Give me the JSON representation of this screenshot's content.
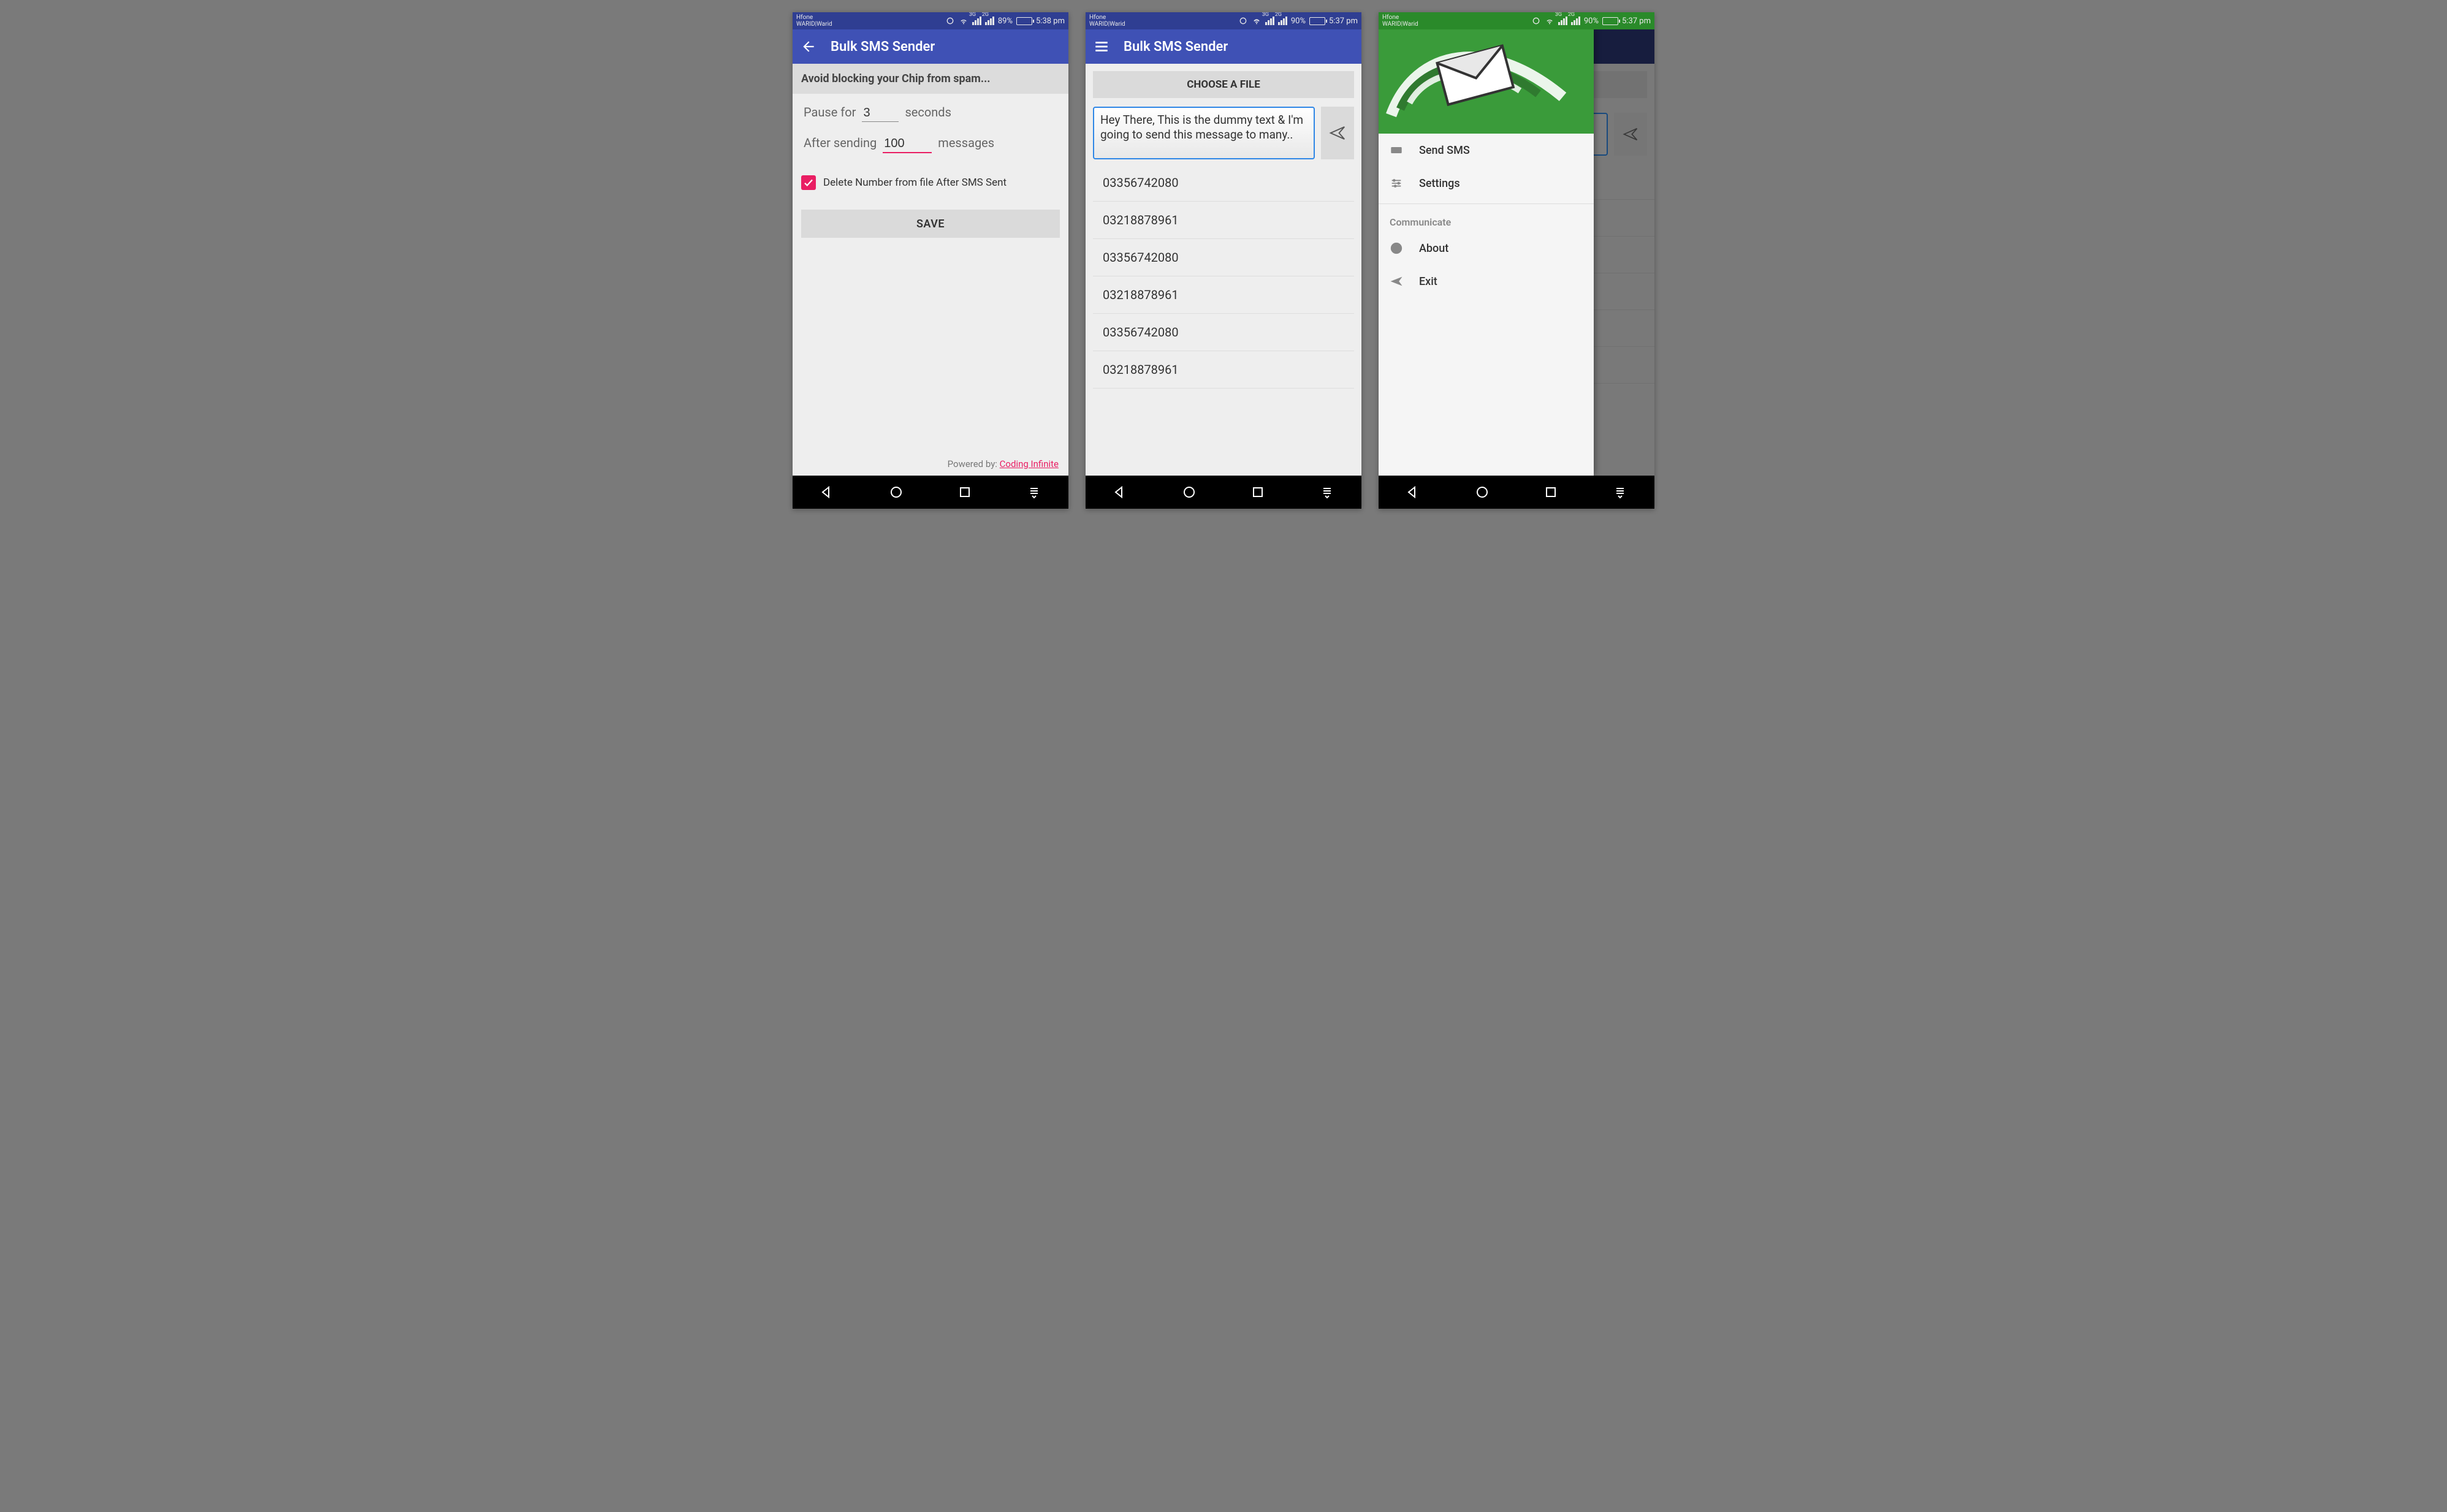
{
  "screens": {
    "s1": {
      "status": {
        "carrier": "Hfone\nWARID|Warid",
        "sig1": "3G",
        "sig2": "2G",
        "battery_pct": "89%",
        "time": "5:38 pm"
      },
      "appbar_title": "Bulk SMS Sender",
      "section_head": "Avoid blocking your Chip from spam...",
      "pause_label_pre": "Pause for",
      "pause_value": "3",
      "pause_label_post": "seconds",
      "after_label_pre": "After sending",
      "after_value": "100",
      "after_label_post": "messages",
      "checkbox_label": "Delete Number from file After SMS Sent",
      "save_label": "SAVE",
      "footer_pre": "Powered by: ",
      "footer_link": "Coding Infinite"
    },
    "s2": {
      "status": {
        "carrier": "Hfone\nWARID|Warid",
        "sig1": "3G",
        "sig2": "2G",
        "battery_pct": "90%",
        "time": "5:37 pm"
      },
      "appbar_title": "Bulk SMS Sender",
      "choose_file": "CHOOSE A FILE",
      "message_text": "Hey There, This is the dummy text & I'm going to send this message to many..",
      "numbers": [
        "03356742080",
        "03218878961",
        "03356742080",
        "03218878961",
        "03356742080",
        "03218878961"
      ]
    },
    "s3": {
      "status": {
        "carrier": "Hfone\nWARID|Warid",
        "sig1": "3G",
        "sig2": "2G",
        "battery_pct": "90%",
        "time": "5:37 pm"
      },
      "drawer": {
        "items_top": [
          {
            "label": "Send SMS"
          },
          {
            "label": "Settings"
          }
        ],
        "section": "Communicate",
        "items_bottom": [
          {
            "label": "About"
          },
          {
            "label": "Exit"
          }
        ]
      }
    }
  }
}
